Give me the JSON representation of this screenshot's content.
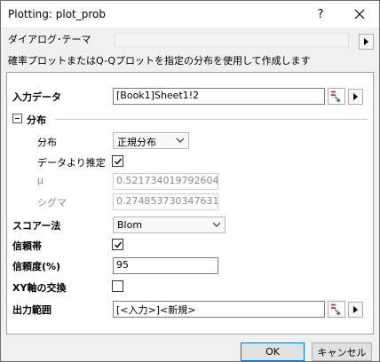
{
  "window": {
    "title": "Plotting: plot_prob",
    "help_label": "?"
  },
  "theme": {
    "label": "ダイアログ･テーマ",
    "value": ""
  },
  "description": "確率プロットまたはQ-Qプロットを指定の分布を使用して作成します",
  "input_data": {
    "label": "入力データ",
    "value": "[Book1]Sheet1!2"
  },
  "distribution": {
    "section_label": "分布",
    "dist_label": "分布",
    "dist_value": "正規分布",
    "estimate_label": "データより推定",
    "estimate_checked": true,
    "mu_label": "μ",
    "mu_value": "0.521734019792604",
    "sigma_label": "シグマ",
    "sigma_value": "0.274853730347631"
  },
  "score": {
    "label": "スコアー法",
    "value": "Blom"
  },
  "confidence_band": {
    "label": "信頼帯",
    "checked": true
  },
  "confidence_level": {
    "label": "信頼度(%)",
    "value": "95"
  },
  "xy_swap": {
    "label": "XY軸の交換",
    "checked": false
  },
  "output_range": {
    "label": "出力範囲",
    "value": "[<入力>]<新規>"
  },
  "buttons": {
    "ok": "OK",
    "cancel": "キャンセル"
  },
  "colors": {
    "accent": "#0078d7",
    "pick_red": "#d42a2a",
    "pick_blue": "#1f5fbf"
  }
}
